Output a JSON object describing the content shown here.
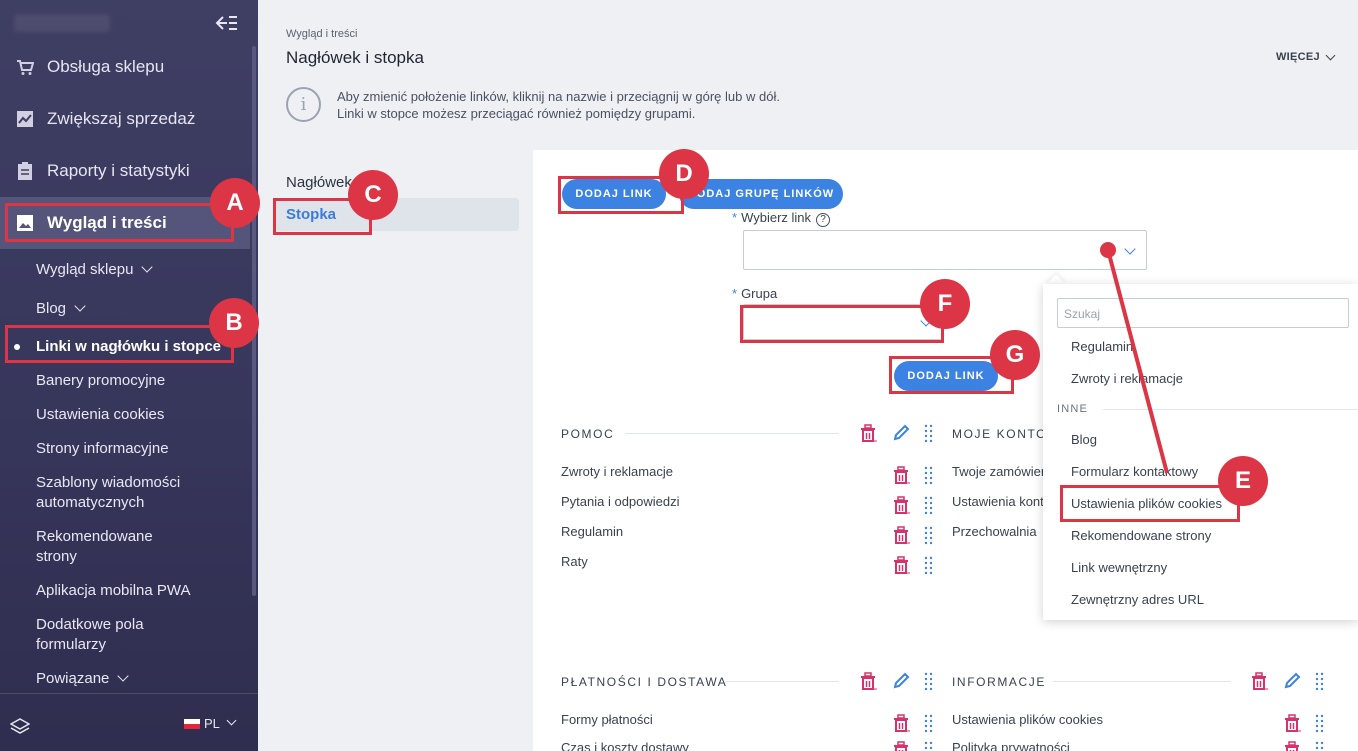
{
  "sidebar": {
    "main_items": [
      {
        "label": "Obsługa sklepu",
        "icon": "cart-icon"
      },
      {
        "label": "Zwiększaj sprzedaż",
        "icon": "chart-icon"
      },
      {
        "label": "Raporty i statystyki",
        "icon": "clipboard-icon"
      },
      {
        "label": "Wygląd i treści",
        "icon": "image-icon"
      }
    ],
    "sub_items": [
      "Wygląd sklepu",
      "Blog",
      "Linki w nagłówku i stopce",
      "Banery promocyjne",
      "Ustawienia cookies",
      "Strony informacyjne",
      "Szablony wiadomości",
      "automatycznych",
      "Rekomendowane",
      "strony",
      "Aplikacja mobilna PWA",
      "Dodatkowe pola",
      "formularzy",
      "Powiązane"
    ],
    "lang": "PL"
  },
  "header": {
    "breadcrumb": "Wygląd i treści",
    "title": "Nagłówek i stopka",
    "more": "WIĘCEJ",
    "info_line1": "Aby zmienić położenie linków, kliknij na nazwie i przeciągnij w górę lub w dół.",
    "info_line2": "Linki w stopce możesz przeciągać również pomiędzy grupami."
  },
  "tabs": {
    "header": "Nagłówek",
    "footer": "Stopka"
  },
  "form": {
    "add_link": "DODAJ LINK",
    "add_group": "DODAJ GRUPĘ LINKÓW",
    "choose_link_label": "Wybierz link",
    "group_label": "Grupa",
    "required_mark": "*",
    "help_mark": "?",
    "submit": "DODAJ LINK"
  },
  "groups": [
    {
      "title": "POMOC",
      "links": [
        "Zwroty i reklamacje",
        "Pytania i odpowiedzi",
        "Regulamin",
        "Raty"
      ]
    },
    {
      "title": "MOJE KONTO",
      "links": [
        "Twoje zamówienia",
        "Ustawienia konta",
        "Przechowalnia"
      ]
    },
    {
      "title": "PŁATNOŚCI I DOSTAWA",
      "links": [
        "Formy płatności",
        "Czas i koszty dostawy"
      ]
    },
    {
      "title": "INFORMACJE",
      "links": [
        "Ustawienia plików cookies",
        "Polityka prywatności"
      ]
    }
  ],
  "dropdown": {
    "search_placeholder": "Szukaj",
    "items_top": [
      "Regulamin",
      "Zwroty i reklamacje"
    ],
    "group_label": "INNE",
    "items": [
      "Blog",
      "Formularz kontaktowy",
      "Ustawienia plików cookies",
      "Rekomendowane strony",
      "Link wewnętrzny",
      "Zewnętrzny adres URL"
    ]
  },
  "annotations": {
    "a": "A",
    "b": "B",
    "c": "C",
    "d": "D",
    "e": "E",
    "f": "F",
    "g": "G"
  },
  "colors": {
    "accent": "#3c82e2",
    "highlight": "#dc3545",
    "sidebar": "#3f3e63",
    "delete": "#d6336c"
  }
}
